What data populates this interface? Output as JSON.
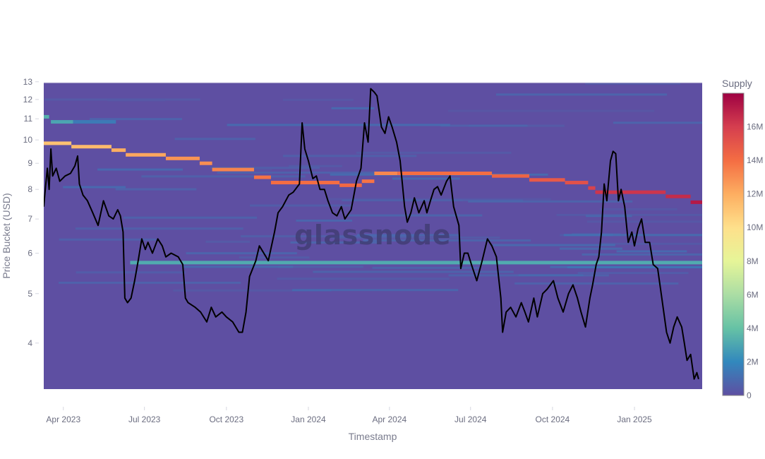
{
  "chart_data": {
    "type": "heatmap",
    "title": "",
    "xlabel": "Timestamp",
    "ylabel": "Price Bucket (USD)",
    "y_scale": "log",
    "ylim": [
      3.25,
      12.95
    ],
    "xlim": [
      "2023-03-10",
      "2025-03-18"
    ],
    "x_ticks": [
      {
        "date": "2023-04-01",
        "label": "Apr 2023"
      },
      {
        "date": "2023-07-01",
        "label": "Jul 2023"
      },
      {
        "date": "2023-10-01",
        "label": "Oct 2023"
      },
      {
        "date": "2024-01-01",
        "label": "Jan 2024"
      },
      {
        "date": "2024-04-01",
        "label": "Apr 2024"
      },
      {
        "date": "2024-07-01",
        "label": "Jul 2024"
      },
      {
        "date": "2024-10-01",
        "label": "Oct 2024"
      },
      {
        "date": "2025-01-01",
        "label": "Jan 2025"
      }
    ],
    "y_ticks": [
      4,
      5,
      6,
      7,
      8,
      9,
      10,
      11,
      12,
      13
    ],
    "grid": false,
    "colorbar": {
      "title": "Supply",
      "range": [
        0,
        18000000
      ],
      "ticks": [
        {
          "value": 0,
          "label": "0"
        },
        {
          "value": 2000000,
          "label": "2M"
        },
        {
          "value": 4000000,
          "label": "4M"
        },
        {
          "value": 6000000,
          "label": "6M"
        },
        {
          "value": 8000000,
          "label": "8M"
        },
        {
          "value": 10000000,
          "label": "10M"
        },
        {
          "value": 12000000,
          "label": "12M"
        },
        {
          "value": 14000000,
          "label": "14M"
        },
        {
          "value": 16000000,
          "label": "16M"
        }
      ],
      "colorscale": [
        "#5e4fa2",
        "#3288bd",
        "#66c2a5",
        "#abdda4",
        "#e6f598",
        "#fee08b",
        "#fdae61",
        "#f46d43",
        "#d53e4f",
        "#9e0142"
      ],
      "placement": "right"
    },
    "background_supply": 0,
    "heatmap_bands": [
      {
        "name": "dominant-cost-basis-band",
        "segments": [
          {
            "start": "2023-03-10",
            "end": "2023-04-10",
            "price": 9.85,
            "supply": 11200000
          },
          {
            "start": "2023-04-10",
            "end": "2023-05-25",
            "price": 9.7,
            "supply": 11500000
          },
          {
            "start": "2023-05-25",
            "end": "2023-06-10",
            "price": 9.55,
            "supply": 12000000
          },
          {
            "start": "2023-06-10",
            "end": "2023-07-25",
            "price": 9.35,
            "supply": 12200000
          },
          {
            "start": "2023-07-25",
            "end": "2023-09-01",
            "price": 9.2,
            "supply": 12800000
          },
          {
            "start": "2023-09-01",
            "end": "2023-09-15",
            "price": 9.0,
            "supply": 13000000
          },
          {
            "start": "2023-09-15",
            "end": "2023-11-01",
            "price": 8.75,
            "supply": 13300000
          },
          {
            "start": "2023-11-01",
            "end": "2023-11-20",
            "price": 8.45,
            "supply": 13800000
          },
          {
            "start": "2023-11-20",
            "end": "2024-02-05",
            "price": 8.25,
            "supply": 14000000
          },
          {
            "start": "2024-02-05",
            "end": "2024-03-01",
            "price": 8.15,
            "supply": 14200000
          },
          {
            "start": "2024-03-01",
            "end": "2024-03-15",
            "price": 8.3,
            "supply": 13800000
          },
          {
            "start": "2024-03-15",
            "end": "2024-04-10",
            "price": 8.6,
            "supply": 13200000
          },
          {
            "start": "2024-04-10",
            "end": "2024-07-25",
            "price": 8.6,
            "supply": 14000000
          },
          {
            "start": "2024-07-25",
            "end": "2024-09-05",
            "price": 8.5,
            "supply": 14400000
          },
          {
            "start": "2024-09-05",
            "end": "2024-10-15",
            "price": 8.35,
            "supply": 14800000
          },
          {
            "start": "2024-10-15",
            "end": "2024-11-10",
            "price": 8.25,
            "supply": 15200000
          },
          {
            "start": "2024-11-10",
            "end": "2024-11-18",
            "price": 8.05,
            "supply": 15800000
          },
          {
            "start": "2024-11-18",
            "end": "2025-02-05",
            "price": 7.9,
            "supply": 16300000
          },
          {
            "start": "2025-02-05",
            "end": "2025-03-05",
            "price": 7.75,
            "supply": 16600000
          },
          {
            "start": "2025-03-05",
            "end": "2025-03-18",
            "price": 7.55,
            "supply": 17200000
          }
        ]
      },
      {
        "name": "persistent-support-band",
        "segments": [
          {
            "start": "2023-06-15",
            "end": "2025-03-18",
            "price": 5.75,
            "supply": 3200000
          }
        ]
      },
      {
        "name": "early-high-band",
        "segments": [
          {
            "start": "2023-03-10",
            "end": "2023-03-16",
            "price": 11.1,
            "supply": 3400000
          },
          {
            "start": "2023-03-18",
            "end": "2023-04-12",
            "price": 10.85,
            "supply": 3000000
          },
          {
            "start": "2023-04-12",
            "end": "2023-05-30",
            "price": 10.85,
            "supply": 1500000
          }
        ]
      }
    ],
    "series": [
      {
        "name": "Price",
        "type": "line",
        "color": "#000000",
        "points": [
          [
            "2023-03-10",
            7.4
          ],
          [
            "2023-03-12",
            8.1
          ],
          [
            "2023-03-14",
            8.8
          ],
          [
            "2023-03-16",
            8.0
          ],
          [
            "2023-03-18",
            9.6
          ],
          [
            "2023-03-20",
            8.5
          ],
          [
            "2023-03-24",
            8.8
          ],
          [
            "2023-03-28",
            8.3
          ],
          [
            "2023-04-03",
            8.5
          ],
          [
            "2023-04-09",
            8.6
          ],
          [
            "2023-04-14",
            8.9
          ],
          [
            "2023-04-17",
            9.3
          ],
          [
            "2023-04-19",
            8.2
          ],
          [
            "2023-04-23",
            7.8
          ],
          [
            "2023-04-28",
            7.6
          ],
          [
            "2023-05-04",
            7.2
          ],
          [
            "2023-05-10",
            6.8
          ],
          [
            "2023-05-16",
            7.6
          ],
          [
            "2023-05-22",
            7.1
          ],
          [
            "2023-05-27",
            7.0
          ],
          [
            "2023-06-01",
            7.3
          ],
          [
            "2023-06-04",
            7.1
          ],
          [
            "2023-06-07",
            6.6
          ],
          [
            "2023-06-09",
            4.9
          ],
          [
            "2023-06-12",
            4.8
          ],
          [
            "2023-06-16",
            4.9
          ],
          [
            "2023-06-20",
            5.3
          ],
          [
            "2023-06-24",
            5.8
          ],
          [
            "2023-06-28",
            6.4
          ],
          [
            "2023-07-02",
            6.1
          ],
          [
            "2023-07-05",
            6.3
          ],
          [
            "2023-07-10",
            6.0
          ],
          [
            "2023-07-16",
            6.4
          ],
          [
            "2023-07-21",
            6.2
          ],
          [
            "2023-07-25",
            5.9
          ],
          [
            "2023-07-31",
            6.0
          ],
          [
            "2023-08-08",
            5.9
          ],
          [
            "2023-08-13",
            5.7
          ],
          [
            "2023-08-16",
            4.9
          ],
          [
            "2023-08-19",
            4.8
          ],
          [
            "2023-08-27",
            4.7
          ],
          [
            "2023-09-02",
            4.6
          ],
          [
            "2023-09-09",
            4.4
          ],
          [
            "2023-09-14",
            4.7
          ],
          [
            "2023-09-19",
            4.5
          ],
          [
            "2023-09-26",
            4.6
          ],
          [
            "2023-10-01",
            4.5
          ],
          [
            "2023-10-08",
            4.4
          ],
          [
            "2023-10-15",
            4.2
          ],
          [
            "2023-10-19",
            4.2
          ],
          [
            "2023-10-23",
            4.6
          ],
          [
            "2023-10-27",
            5.4
          ],
          [
            "2023-11-03",
            5.8
          ],
          [
            "2023-11-07",
            6.2
          ],
          [
            "2023-11-12",
            6.0
          ],
          [
            "2023-11-17",
            5.8
          ],
          [
            "2023-11-24",
            6.6
          ],
          [
            "2023-11-28",
            7.2
          ],
          [
            "2023-12-03",
            7.4
          ],
          [
            "2023-12-10",
            7.8
          ],
          [
            "2023-12-15",
            7.9
          ],
          [
            "2023-12-22",
            8.2
          ],
          [
            "2023-12-25",
            10.8
          ],
          [
            "2023-12-28",
            9.6
          ],
          [
            "2024-01-01",
            9.1
          ],
          [
            "2024-01-06",
            8.4
          ],
          [
            "2024-01-10",
            8.5
          ],
          [
            "2024-01-14",
            8.0
          ],
          [
            "2024-01-19",
            8.0
          ],
          [
            "2024-01-23",
            7.6
          ],
          [
            "2024-01-28",
            7.2
          ],
          [
            "2024-02-02",
            7.1
          ],
          [
            "2024-02-07",
            7.4
          ],
          [
            "2024-02-11",
            7.0
          ],
          [
            "2024-02-18",
            7.3
          ],
          [
            "2024-02-24",
            8.3
          ],
          [
            "2024-02-29",
            8.8
          ],
          [
            "2024-03-04",
            10.8
          ],
          [
            "2024-03-08",
            9.9
          ],
          [
            "2024-03-11",
            12.6
          ],
          [
            "2024-03-15",
            12.4
          ],
          [
            "2024-03-18",
            12.2
          ],
          [
            "2024-03-23",
            10.6
          ],
          [
            "2024-03-27",
            10.3
          ],
          [
            "2024-03-31",
            11.1
          ],
          [
            "2024-04-04",
            10.6
          ],
          [
            "2024-04-09",
            9.9
          ],
          [
            "2024-04-13",
            9.1
          ],
          [
            "2024-04-18",
            7.4
          ],
          [
            "2024-04-21",
            6.9
          ],
          [
            "2024-04-25",
            7.2
          ],
          [
            "2024-04-29",
            7.7
          ],
          [
            "2024-05-04",
            7.2
          ],
          [
            "2024-05-10",
            7.6
          ],
          [
            "2024-05-13",
            7.2
          ],
          [
            "2024-05-17",
            7.6
          ],
          [
            "2024-05-21",
            8.0
          ],
          [
            "2024-05-25",
            8.1
          ],
          [
            "2024-05-29",
            7.8
          ],
          [
            "2024-06-04",
            8.3
          ],
          [
            "2024-06-08",
            8.5
          ],
          [
            "2024-06-12",
            7.4
          ],
          [
            "2024-06-18",
            6.8
          ],
          [
            "2024-06-20",
            5.6
          ],
          [
            "2024-06-24",
            6.0
          ],
          [
            "2024-06-28",
            6.0
          ],
          [
            "2024-07-02",
            5.7
          ],
          [
            "2024-07-08",
            5.3
          ],
          [
            "2024-07-14",
            5.8
          ],
          [
            "2024-07-20",
            6.4
          ],
          [
            "2024-07-25",
            6.2
          ],
          [
            "2024-07-30",
            5.9
          ],
          [
            "2024-08-04",
            4.9
          ],
          [
            "2024-08-06",
            4.2
          ],
          [
            "2024-08-10",
            4.6
          ],
          [
            "2024-08-15",
            4.7
          ],
          [
            "2024-08-21",
            4.5
          ],
          [
            "2024-08-27",
            4.8
          ],
          [
            "2024-08-31",
            4.6
          ],
          [
            "2024-09-04",
            4.4
          ],
          [
            "2024-09-10",
            4.9
          ],
          [
            "2024-09-14",
            4.5
          ],
          [
            "2024-09-20",
            5.0
          ],
          [
            "2024-09-25",
            5.1
          ],
          [
            "2024-10-02",
            5.3
          ],
          [
            "2024-10-07",
            4.9
          ],
          [
            "2024-10-13",
            4.6
          ],
          [
            "2024-10-19",
            5.0
          ],
          [
            "2024-10-24",
            5.2
          ],
          [
            "2024-10-29",
            4.9
          ],
          [
            "2024-11-02",
            4.6
          ],
          [
            "2024-11-07",
            4.3
          ],
          [
            "2024-11-12",
            4.9
          ],
          [
            "2024-11-15",
            5.2
          ],
          [
            "2024-11-19",
            5.7
          ],
          [
            "2024-11-22",
            5.9
          ],
          [
            "2024-11-25",
            6.6
          ],
          [
            "2024-11-28",
            8.2
          ],
          [
            "2024-12-01",
            7.6
          ],
          [
            "2024-12-05",
            9.1
          ],
          [
            "2024-12-08",
            9.5
          ],
          [
            "2024-12-11",
            9.4
          ],
          [
            "2024-12-14",
            7.6
          ],
          [
            "2024-12-17",
            8.0
          ],
          [
            "2024-12-21",
            7.4
          ],
          [
            "2024-12-25",
            6.3
          ],
          [
            "2024-12-29",
            6.6
          ],
          [
            "2025-01-01",
            6.2
          ],
          [
            "2025-01-05",
            6.7
          ],
          [
            "2025-01-09",
            7.0
          ],
          [
            "2025-01-13",
            6.3
          ],
          [
            "2025-01-18",
            6.3
          ],
          [
            "2025-01-22",
            5.7
          ],
          [
            "2025-01-27",
            5.6
          ],
          [
            "2025-01-31",
            5.0
          ],
          [
            "2025-02-06",
            4.2
          ],
          [
            "2025-02-10",
            4.0
          ],
          [
            "2025-02-14",
            4.3
          ],
          [
            "2025-02-18",
            4.5
          ],
          [
            "2025-02-23",
            4.3
          ],
          [
            "2025-02-26",
            4.0
          ],
          [
            "2025-03-01",
            3.7
          ],
          [
            "2025-03-05",
            3.8
          ],
          [
            "2025-03-09",
            3.4
          ],
          [
            "2025-03-12",
            3.5
          ],
          [
            "2025-03-14",
            3.4
          ]
        ]
      }
    ],
    "watermark": "glassnode"
  }
}
